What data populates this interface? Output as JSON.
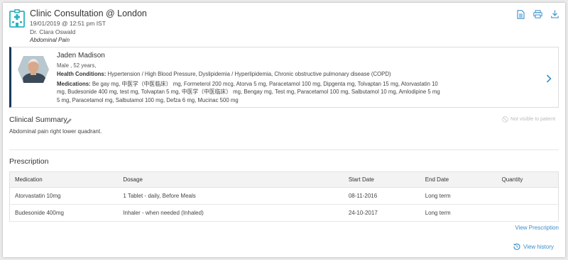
{
  "header": {
    "title": "Clinic Consultation @ London",
    "datetime": "19/01/2019 @ 12:51 pm IST",
    "doctor": "Dr. Clara Oswald",
    "reason": "Abdominal Pain",
    "icons": [
      "clinic-building-icon",
      "document-icon",
      "print-icon",
      "download-icon"
    ]
  },
  "patient": {
    "name": "Jaden Madison",
    "info": "Male , 52 years,",
    "conditions_label": "Health Conditions:",
    "conditions": "Hypertension / High Blood Pressure, Dyslipidemia / Hyperlipidemia, Chronic obstructive pulmonary disease (COPD)",
    "medications_label": "Medications:",
    "medications": "Be gay mg, 中医学（中医临床） mg, Formeterol 200 mcg, Atorva 5 mg, Paracetamol 100 mg, Dipgenta mg, Tolvaptan 15 mg, Atorvastatin 10 mg, Budesonide 400 mg, test mg, Tolvaptan 5 mg, 中医学（中医临床） mg, Bengay mg, Test mg, Paracetamol 100 mg, Salbutamol 10 mg, Amlodipine 5 mg 5 mg, Paracetamol mg, Salbutamol 100 mg, Defza 6 mg, Mucinac 500 mg"
  },
  "clinical_summary": {
    "title": "Clinical Summary",
    "not_visible": "Not visible to patient",
    "text": "Abdominal pain right lower quadrant."
  },
  "prescription": {
    "title": "Prescription",
    "columns": [
      "Medication",
      "Dosage",
      "Start Date",
      "End Date",
      "Quantity"
    ],
    "rows": [
      [
        "Atorvastatin 10mg",
        "1 Tablet - daily, Before Meals",
        "08-11-2016",
        "Long term",
        ""
      ],
      [
        "Budesonide 400mg",
        "Inhaler - when needed (Inhaled)",
        "24-10-2017",
        "Long term",
        ""
      ]
    ],
    "view_prescription": "View Prescription"
  },
  "footer": {
    "view_history": "View history"
  },
  "colors": {
    "accent": "#3a8fc8",
    "teal": "#2bb3c0",
    "patient_bar": "#17395f"
  }
}
